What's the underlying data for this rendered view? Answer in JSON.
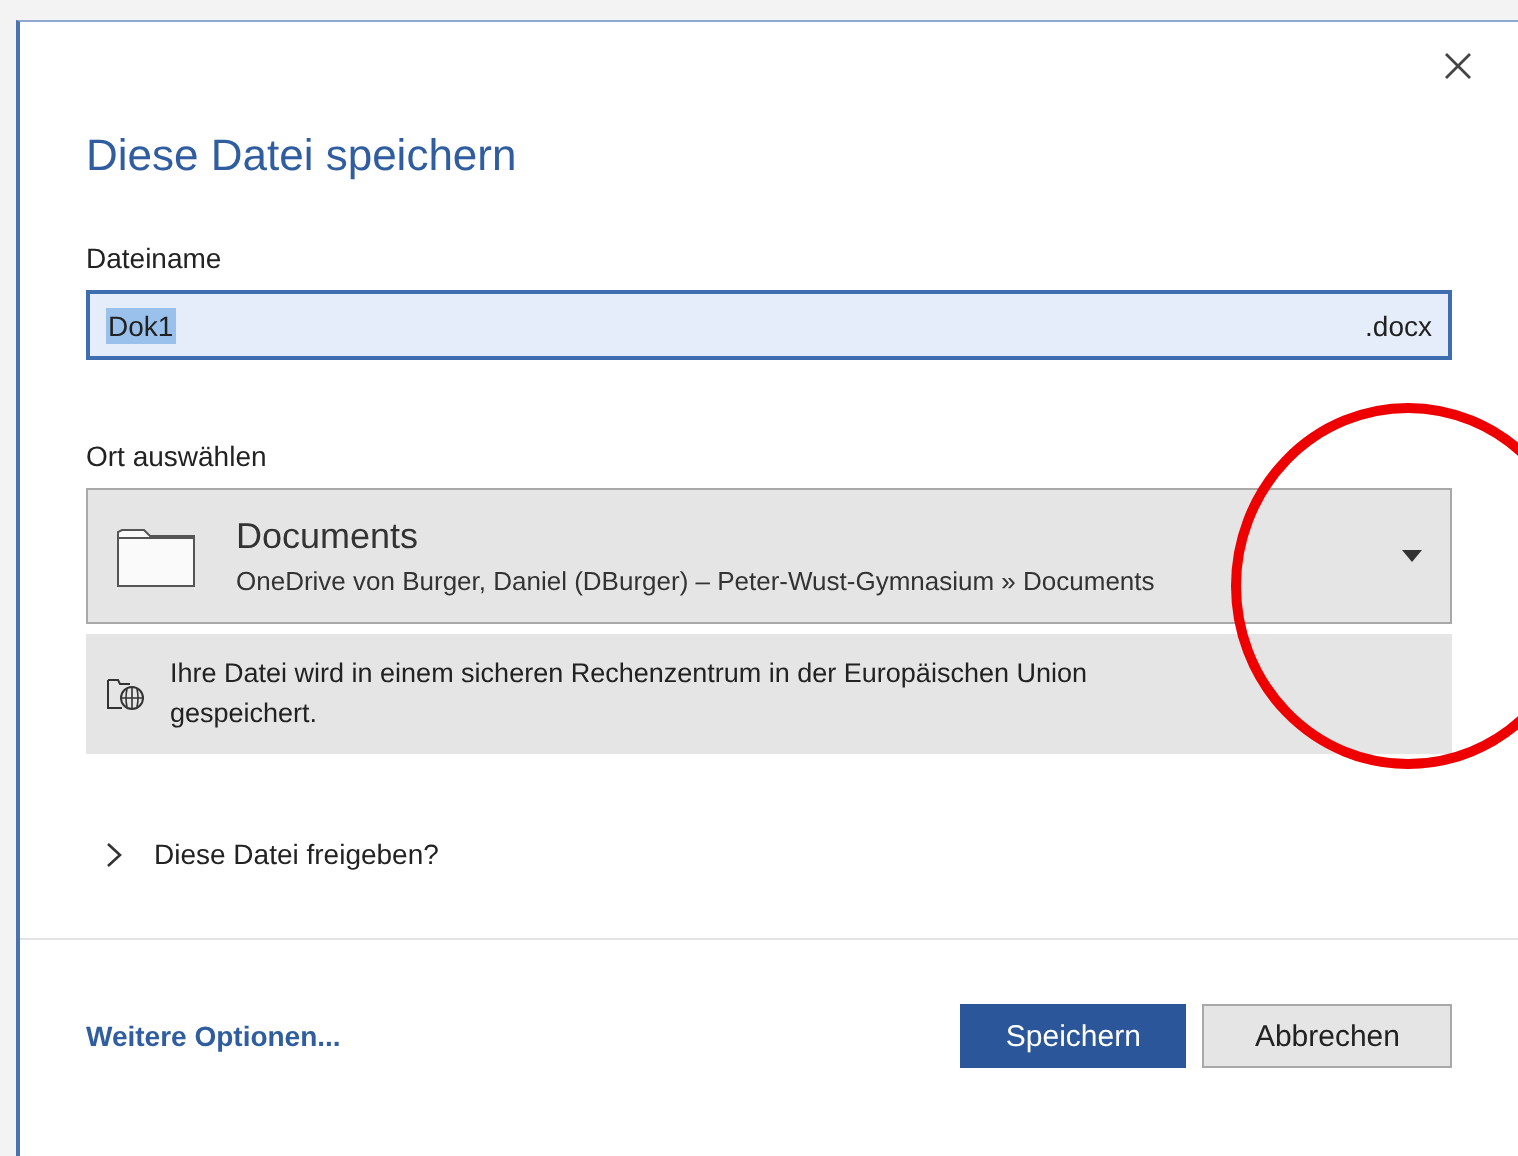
{
  "dialog": {
    "title": "Diese Datei speichern"
  },
  "filename": {
    "label": "Dateiname",
    "value": "Dok1",
    "text_selected": true,
    "extension": ".docx"
  },
  "location": {
    "label": "Ort auswählen",
    "name": "Documents",
    "path": "OneDrive von Burger, Daniel (DBurger) – Peter-Wust-Gymnasium » Documents"
  },
  "info": {
    "text": "Ihre Datei wird in einem sicheren Rechenzentrum in der Europäischen Union gespeichert."
  },
  "share": {
    "label": "Diese Datei freigeben?",
    "expanded": false
  },
  "footer": {
    "link": "Weitere Optionen...",
    "buttons": [
      {
        "label": "Speichern",
        "kind": "primary"
      },
      {
        "label": "Abbrechen",
        "kind": "secondary"
      }
    ]
  },
  "annotation": {
    "kind": "circle"
  }
}
